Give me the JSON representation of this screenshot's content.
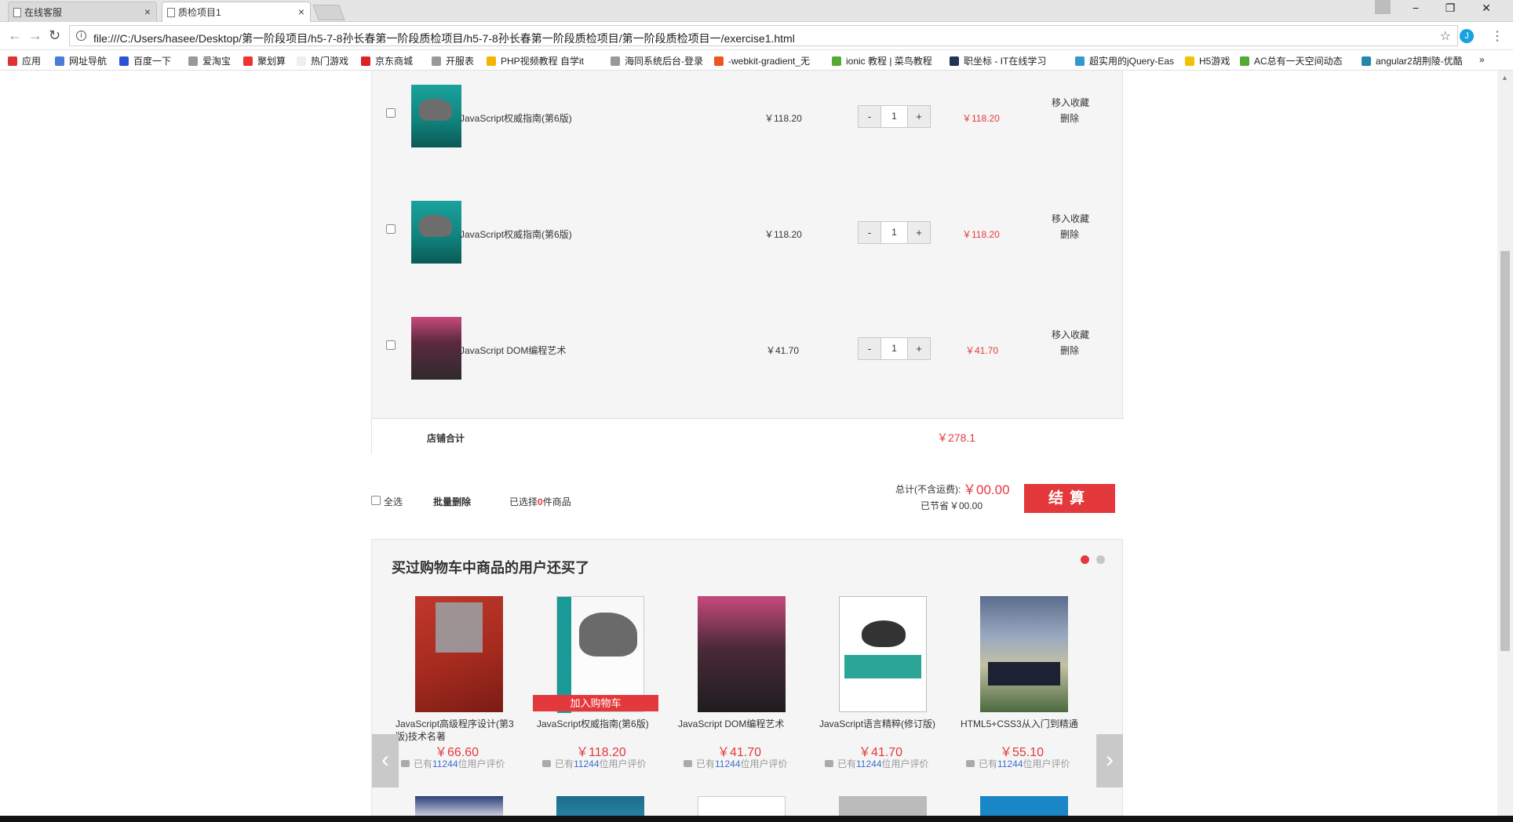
{
  "browser": {
    "tabs": [
      {
        "label": "在线客服",
        "active": false
      },
      {
        "label": "质检项目1",
        "active": true
      }
    ],
    "url": "file:///C:/Users/hasee/Desktop/第一阶段项目/h5-7-8孙长春第一阶段质检项目/h5-7-8孙长春第一阶段质检项目/第一阶段质检项目一/exercise1.html",
    "extension_letter": "J",
    "window_controls": {
      "minimize": "−",
      "restore": "❐",
      "close": "✕"
    },
    "bookmarks": [
      {
        "label": "应用",
        "color": "#d33"
      },
      {
        "label": "网址导航",
        "color": "#4a7bd6"
      },
      {
        "label": "百度一下",
        "color": "#2a54d6"
      },
      {
        "label": "爱淘宝",
        "color": "#999"
      },
      {
        "label": "聚划算",
        "color": "#e33"
      },
      {
        "label": "热门游戏",
        "color": "#eee"
      },
      {
        "label": "京东商城",
        "color": "#d22"
      },
      {
        "label": "开服表",
        "color": "#999"
      },
      {
        "label": "PHP视频教程 自学it",
        "color": "#f5b400"
      },
      {
        "label": "海同系统后台-登录",
        "color": "#999"
      },
      {
        "label": "-webkit-gradient_无",
        "color": "#e52"
      },
      {
        "label": "ionic 教程 | 菜鸟教程",
        "color": "#5a3"
      },
      {
        "label": "职坐标 - IT在线学习",
        "color": "#235"
      },
      {
        "label": "超实用的jQuery-Eas",
        "color": "#39c"
      },
      {
        "label": "H5游戏",
        "color": "#f2c200"
      },
      {
        "label": "AC总有一天空间动态",
        "color": "#5a3"
      },
      {
        "label": "angular2胡荆陵-优酷",
        "color": "#28a"
      }
    ]
  },
  "cart": {
    "currency": "￥",
    "items": [
      {
        "name": "JavaScript权威指南(第6版)",
        "price": "￥118.20",
        "qty": "1",
        "total": "￥118.20",
        "fav": "移入收藏",
        "del": "删除",
        "cover": "js"
      },
      {
        "name": "JavaScript权威指南(第6版)",
        "price": "￥118.20",
        "qty": "1",
        "total": "￥118.20",
        "fav": "移入收藏",
        "del": "删除",
        "cover": "js"
      },
      {
        "name": "JavaScript DOM编程艺术",
        "price": "￥41.70",
        "qty": "1",
        "total": "￥41.70",
        "fav": "移入收藏",
        "del": "删除",
        "cover": "dom"
      }
    ],
    "qty_minus": "-",
    "qty_plus": "+",
    "store_total_label": "店铺合计",
    "store_total_value": "￥278.1"
  },
  "settle": {
    "select_all": "全选",
    "batch_delete": "批量删除",
    "selected_prefix": "已选择",
    "selected_count": "0",
    "selected_suffix": "件商品",
    "total_label": "总计(不含运费):",
    "total_value": "￥00.00",
    "saved_label": "已节省",
    "saved_value": "￥00.00",
    "checkout": "结算"
  },
  "recommend": {
    "title": "买过购物车中商品的用户还买了",
    "add_to_cart": "加入购物车",
    "review_prefix": "已有",
    "review_count": "11244",
    "review_suffix": "位用户评价",
    "items": [
      {
        "name": "JavaScript高级程序设计(第3版)技术名著",
        "price": "￥66.60"
      },
      {
        "name": "JavaScript权威指南(第6版)",
        "price": "￥118.20"
      },
      {
        "name": "JavaScript DOM编程艺术",
        "price": "￥41.70"
      },
      {
        "name": "JavaScript语言精粹(修订版)",
        "price": "￥41.70"
      },
      {
        "name": "HTML5+CSS3从入门到精通",
        "price": "￥55.10"
      }
    ],
    "arrow_left": "‹",
    "arrow_right": "›"
  }
}
